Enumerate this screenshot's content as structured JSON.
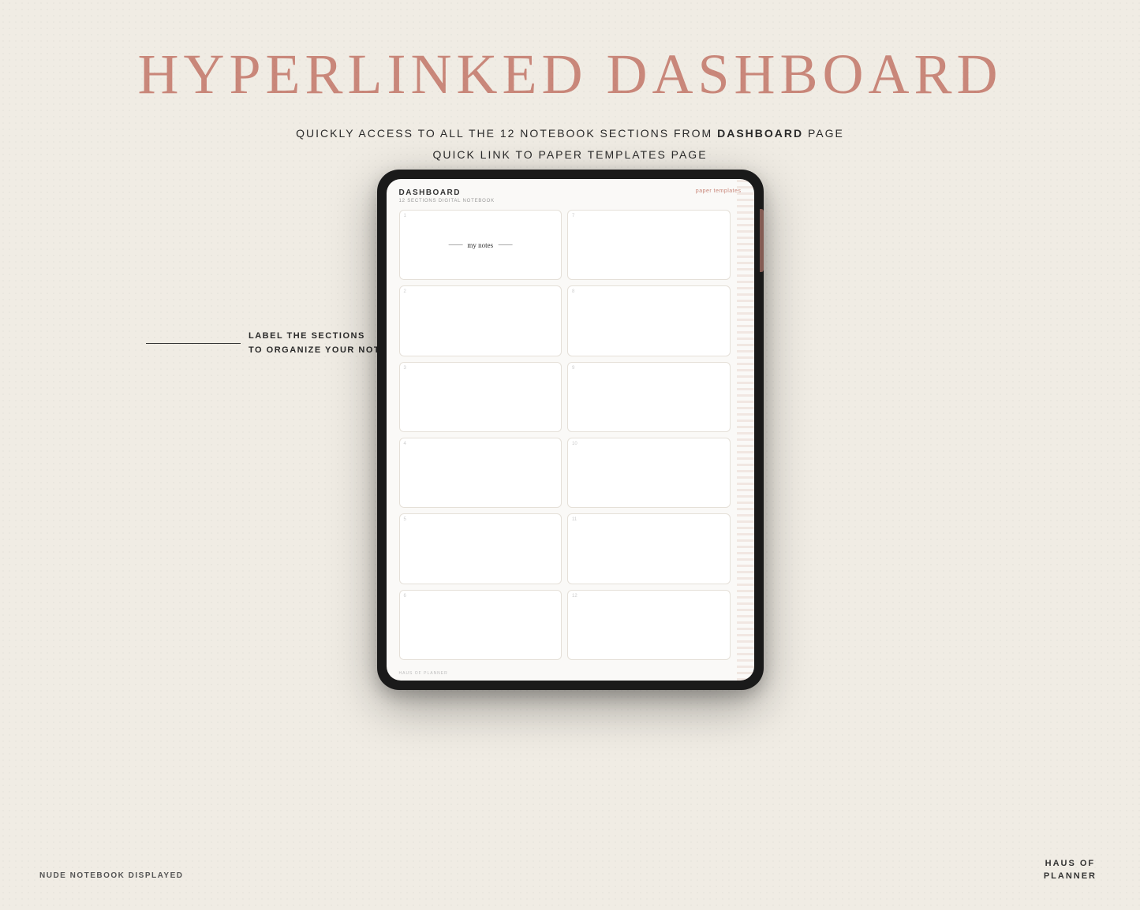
{
  "page": {
    "background_color": "#f0ece4"
  },
  "header": {
    "main_title": "HYPERLINKED DASHBOARD",
    "subtitle_line1": "QUICKLY ACCESS TO ALL THE 12 NOTEBOOK SECTIONS FROM",
    "subtitle_bold": "DASHBOARD",
    "subtitle_line1_end": "PAGE",
    "subtitle_line2": "QUICK LINK TO PAPER TEMPLATES PAGE"
  },
  "annotation": {
    "text_line1": "LABEL THE SECTIONS",
    "text_line2": "TO ORGANIZE YOUR NOTES"
  },
  "tablet": {
    "dashboard_title": "DASHBOARD",
    "notebook_subtitle": "12 SECTIONS DIGITAL NOTEBOOK",
    "paper_templates": "paper templates",
    "footer_brand": "HAUS OF PLANNER",
    "cells": [
      {
        "number": "1",
        "label": "my notes",
        "has_label": true
      },
      {
        "number": "7",
        "label": "",
        "has_label": false
      },
      {
        "number": "2",
        "label": "",
        "has_label": false
      },
      {
        "number": "8",
        "label": "",
        "has_label": false
      },
      {
        "number": "3",
        "label": "",
        "has_label": false
      },
      {
        "number": "9",
        "label": "",
        "has_label": false
      },
      {
        "number": "4",
        "label": "",
        "has_label": false
      },
      {
        "number": "10",
        "label": "",
        "has_label": false
      },
      {
        "number": "5",
        "label": "",
        "has_label": false
      },
      {
        "number": "11",
        "label": "",
        "has_label": false
      },
      {
        "number": "6",
        "label": "",
        "has_label": false
      },
      {
        "number": "12",
        "label": "",
        "has_label": false
      }
    ]
  },
  "bottom_left": {
    "label": "NUDE NOTEBOOK DISPLAYED"
  },
  "bottom_right": {
    "brand_line1": "HAUS OF",
    "brand_line2": "PLANNER"
  }
}
